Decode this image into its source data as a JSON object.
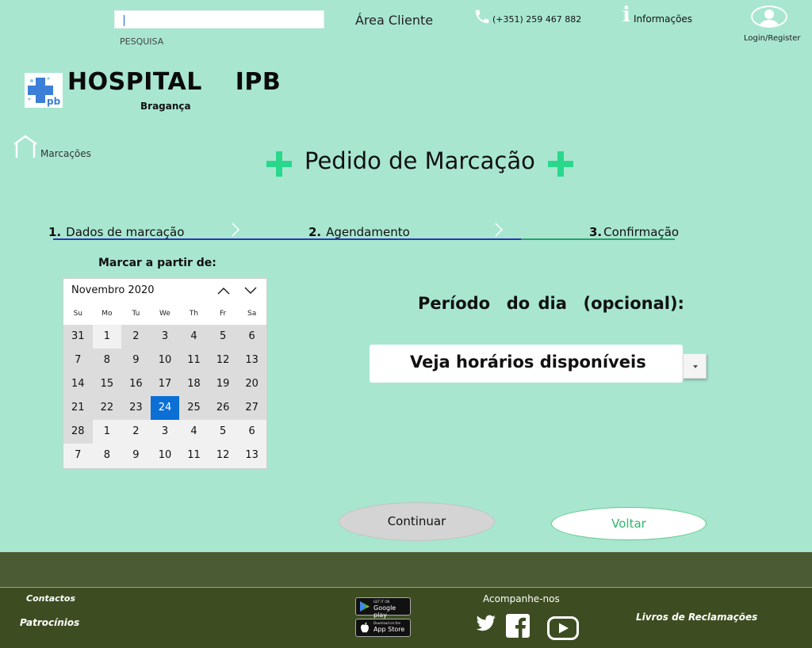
{
  "header": {
    "search_caption": "PESQUISA",
    "client_area": "Área Cliente",
    "phone": "(+351) 259 467 882",
    "info": "Informações",
    "login": "Login/Register"
  },
  "logo": {
    "name": "HOSPITAL  IPB",
    "city": "Bragança"
  },
  "breadcrumb": {
    "label": "Marcações"
  },
  "page_title": "Pedido de Marcação",
  "steps": [
    {
      "number": "1.",
      "label": "Dados de marcação"
    },
    {
      "number": "2.",
      "label": "Agendamento"
    },
    {
      "number": "3.",
      "label": "Confirmação"
    }
  ],
  "calendar": {
    "caption": "Marcar a partir de:",
    "month": "Novembro 2020",
    "weekdays": [
      "Su",
      "Mo",
      "Tu",
      "We",
      "Th",
      "Fr",
      "Sa"
    ],
    "days": [
      {
        "d": "31",
        "in_month": true
      },
      {
        "d": "1",
        "in_month": false
      },
      {
        "d": "2",
        "in_month": true
      },
      {
        "d": "3",
        "in_month": true
      },
      {
        "d": "4",
        "in_month": true
      },
      {
        "d": "5",
        "in_month": true
      },
      {
        "d": "6",
        "in_month": true
      },
      {
        "d": "7",
        "in_month": true
      },
      {
        "d": "8",
        "in_month": true
      },
      {
        "d": "9",
        "in_month": true
      },
      {
        "d": "10",
        "in_month": true
      },
      {
        "d": "11",
        "in_month": true
      },
      {
        "d": "12",
        "in_month": true
      },
      {
        "d": "13",
        "in_month": true
      },
      {
        "d": "14",
        "in_month": true
      },
      {
        "d": "15",
        "in_month": true
      },
      {
        "d": "16",
        "in_month": true
      },
      {
        "d": "17",
        "in_month": true
      },
      {
        "d": "18",
        "in_month": true
      },
      {
        "d": "19",
        "in_month": true
      },
      {
        "d": "20",
        "in_month": true
      },
      {
        "d": "21",
        "in_month": true
      },
      {
        "d": "22",
        "in_month": true
      },
      {
        "d": "23",
        "in_month": true
      },
      {
        "d": "24",
        "in_month": true,
        "selected": true
      },
      {
        "d": "25",
        "in_month": true
      },
      {
        "d": "26",
        "in_month": true
      },
      {
        "d": "27",
        "in_month": true
      },
      {
        "d": "28",
        "in_month": true
      },
      {
        "d": "1",
        "in_month": false
      },
      {
        "d": "2",
        "in_month": false
      },
      {
        "d": "3",
        "in_month": false
      },
      {
        "d": "4",
        "in_month": false
      },
      {
        "d": "5",
        "in_month": false
      },
      {
        "d": "6",
        "in_month": false
      },
      {
        "d": "7",
        "in_month": false
      },
      {
        "d": "8",
        "in_month": false
      },
      {
        "d": "9",
        "in_month": false
      },
      {
        "d": "10",
        "in_month": false
      },
      {
        "d": "11",
        "in_month": false
      },
      {
        "d": "12",
        "in_month": false
      },
      {
        "d": "13",
        "in_month": false
      }
    ],
    "selected_color": "#0b6fd6"
  },
  "period": {
    "label": "Período  do dia  (opcional):",
    "value": "Veja horários disponíveis"
  },
  "actions": {
    "continue": "Continuar",
    "back": "Voltar"
  },
  "footer": {
    "contacts": "Contactos",
    "sponsors": "Patrocínios",
    "follow": "Acompanhe-nos",
    "complaints": "Livros de Reclamações",
    "google_small": "GET IT ON",
    "google_big": "Google play",
    "apple_small": "Download on the",
    "apple_big": "App Store"
  },
  "colors": {
    "background": "#a8e6d0",
    "accent_plus": "#2ad88c",
    "footer": "#3d4d21",
    "progress_done": "#2a36b8",
    "progress_rest": "#2ca06a"
  }
}
